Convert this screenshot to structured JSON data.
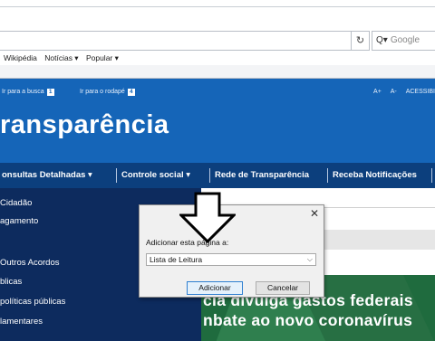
{
  "browser": {
    "reload_icon": "reload-icon",
    "search_placeholder": "Google",
    "search_icon": "search-icon",
    "bookmarks": [
      "Wikipédia",
      "Notícias ▾",
      "Popular ▾"
    ]
  },
  "header": {
    "skip_search": "Ir para a busca",
    "skip_search_key": "1",
    "skip_footer": "Ir para o rodapé",
    "skip_footer_key": "4",
    "font_increase": "A+",
    "font_decrease": "A-",
    "accessibility": "ACESSIBI",
    "brand": "ransparência"
  },
  "nav": {
    "items": [
      {
        "label": "onsultas Detalhadas ▾"
      },
      {
        "label": "Controle social ▾"
      },
      {
        "label": "Rede de Transparência"
      },
      {
        "label": "Receba Notificações"
      }
    ]
  },
  "sidebar": {
    "items": [
      {
        "label": "Cidadão"
      },
      {
        "label": "agamento"
      },
      {
        "label": "Outros Acordos"
      },
      {
        "label": "blicas"
      },
      {
        "label": "políticas públicas"
      },
      {
        "label": "lamentares"
      }
    ]
  },
  "hero": {
    "line1": "cia divulga gastos federais",
    "line2": "nbate ao novo coronavírus"
  },
  "dialog": {
    "close_icon": "close-icon",
    "label": "Adicionar esta página a:",
    "select_value": "Lista de Leitura",
    "add_button": "Adicionar",
    "cancel_button": "Cancelar"
  },
  "colors": {
    "header_blue": "#1565b8",
    "nav_navy": "#0c3f7d",
    "sidebar_navy": "#0d2b5e",
    "hero_green": "#1f6b3e"
  }
}
